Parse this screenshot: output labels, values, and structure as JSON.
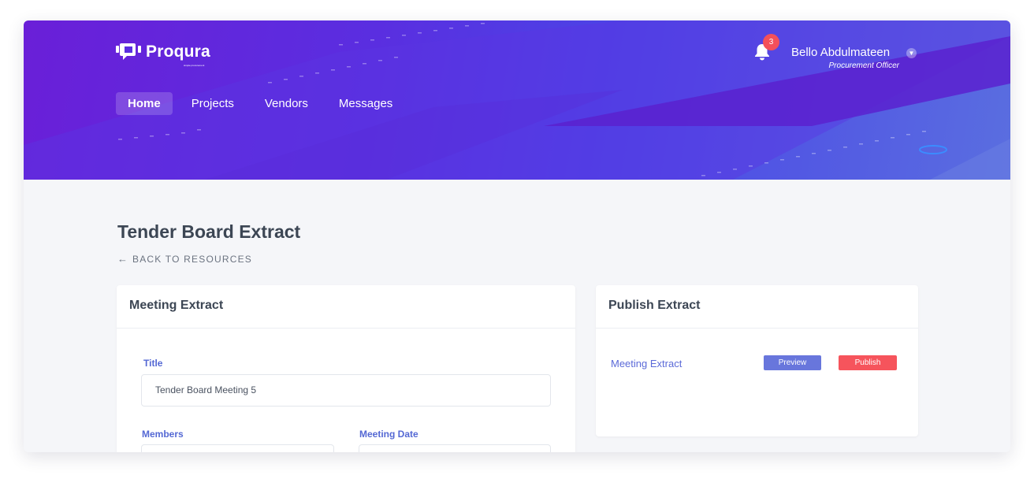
{
  "brand": {
    "name": "Proqura",
    "tagline": "simple procurement"
  },
  "nav": [
    {
      "label": "Home",
      "active": true
    },
    {
      "label": "Projects",
      "active": false
    },
    {
      "label": "Vendors",
      "active": false
    },
    {
      "label": "Messages",
      "active": false
    }
  ],
  "notifications": {
    "count": "3",
    "icon": "bell-icon"
  },
  "user": {
    "name": "Bello Abdulmateen",
    "role": "Procurement Officer"
  },
  "page": {
    "title": "Tender Board Extract",
    "back_label": "BACK TO RESOURCES"
  },
  "meeting_card": {
    "title": "Meeting Extract",
    "fields": {
      "title": {
        "label": "Title",
        "value": "Tender Board Meeting 5"
      },
      "members": {
        "label": "Members",
        "value": ""
      },
      "meeting_date": {
        "label": "Meeting Date",
        "value": ""
      }
    }
  },
  "publish_card": {
    "title": "Publish Extract",
    "item_label": "Meeting Extract",
    "preview_label": "Preview",
    "publish_label": "Publish"
  },
  "colors": {
    "accent": "#5468d4",
    "badge": "#f4505a",
    "publish": "#f6545c",
    "preview": "#6876dc"
  }
}
